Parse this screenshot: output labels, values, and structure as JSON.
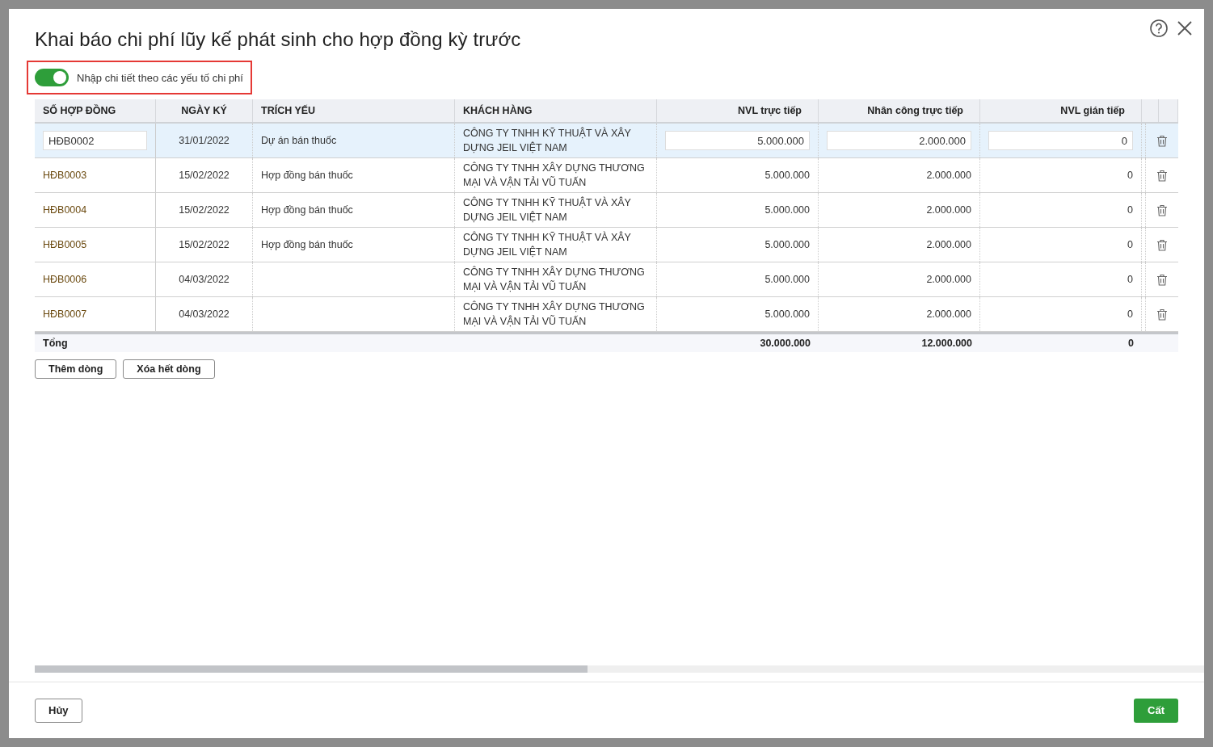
{
  "dialog": {
    "title": "Khai báo chi phí lũy kế phát sinh cho hợp đồng kỳ trước"
  },
  "toggle": {
    "label": "Nhập chi tiết theo các yếu tố chi phí",
    "on": true
  },
  "table": {
    "columns": [
      {
        "label": "SỐ HỢP ĐỒNG"
      },
      {
        "label": "NGÀY KÝ"
      },
      {
        "label": "TRÍCH YẾU"
      },
      {
        "label": "KHÁCH HÀNG"
      },
      {
        "label": "NVL trực tiếp"
      },
      {
        "label": "Nhân công trực tiếp"
      },
      {
        "label": "NVL gián tiếp"
      }
    ],
    "rows": [
      {
        "selected": true,
        "cells": [
          "HĐB0002",
          "31/01/2022",
          "Dự án bán thuốc",
          "CÔNG TY TNHH KỸ THUẬT VÀ XÂY DỰNG JEIL VIỆT NAM",
          "5.000.000",
          "2.000.000",
          "0"
        ]
      },
      {
        "selected": false,
        "cells": [
          "HĐB0003",
          "15/02/2022",
          "Hợp đồng bán thuốc",
          "CÔNG TY TNHH XÂY DỰNG THƯƠNG MẠI VÀ VẬN TẢI VŨ TUẤN",
          "5.000.000",
          "2.000.000",
          "0"
        ]
      },
      {
        "selected": false,
        "cells": [
          "HĐB0004",
          "15/02/2022",
          "Hợp đồng bán thuốc",
          "CÔNG TY TNHH KỸ THUẬT VÀ XÂY DỰNG JEIL VIỆT NAM",
          "5.000.000",
          "2.000.000",
          "0"
        ]
      },
      {
        "selected": false,
        "cells": [
          "HĐB0005",
          "15/02/2022",
          "Hợp đồng bán thuốc",
          "CÔNG TY TNHH KỸ THUẬT VÀ XÂY DỰNG JEIL VIỆT NAM",
          "5.000.000",
          "2.000.000",
          "0"
        ]
      },
      {
        "selected": false,
        "cells": [
          "HĐB0006",
          "04/03/2022",
          "",
          "CÔNG TY TNHH XÂY DỰNG THƯƠNG MẠI VÀ VẬN TẢI VŨ TUẤN",
          "5.000.000",
          "2.000.000",
          "0"
        ]
      },
      {
        "selected": false,
        "cells": [
          "HĐB0007",
          "04/03/2022",
          "",
          "CÔNG TY TNHH XÂY DỰNG THƯƠNG MẠI VÀ VẬN TẢI VŨ TUẤN",
          "5.000.000",
          "2.000.000",
          "0"
        ]
      }
    ],
    "total": {
      "label": "Tổng",
      "values": [
        "30.000.000",
        "12.000.000",
        "0"
      ]
    }
  },
  "table_buttons": [
    "Thêm dòng",
    "Xóa hết dòng"
  ],
  "footer": {
    "cancel": "Hủy",
    "save": "Cất"
  }
}
